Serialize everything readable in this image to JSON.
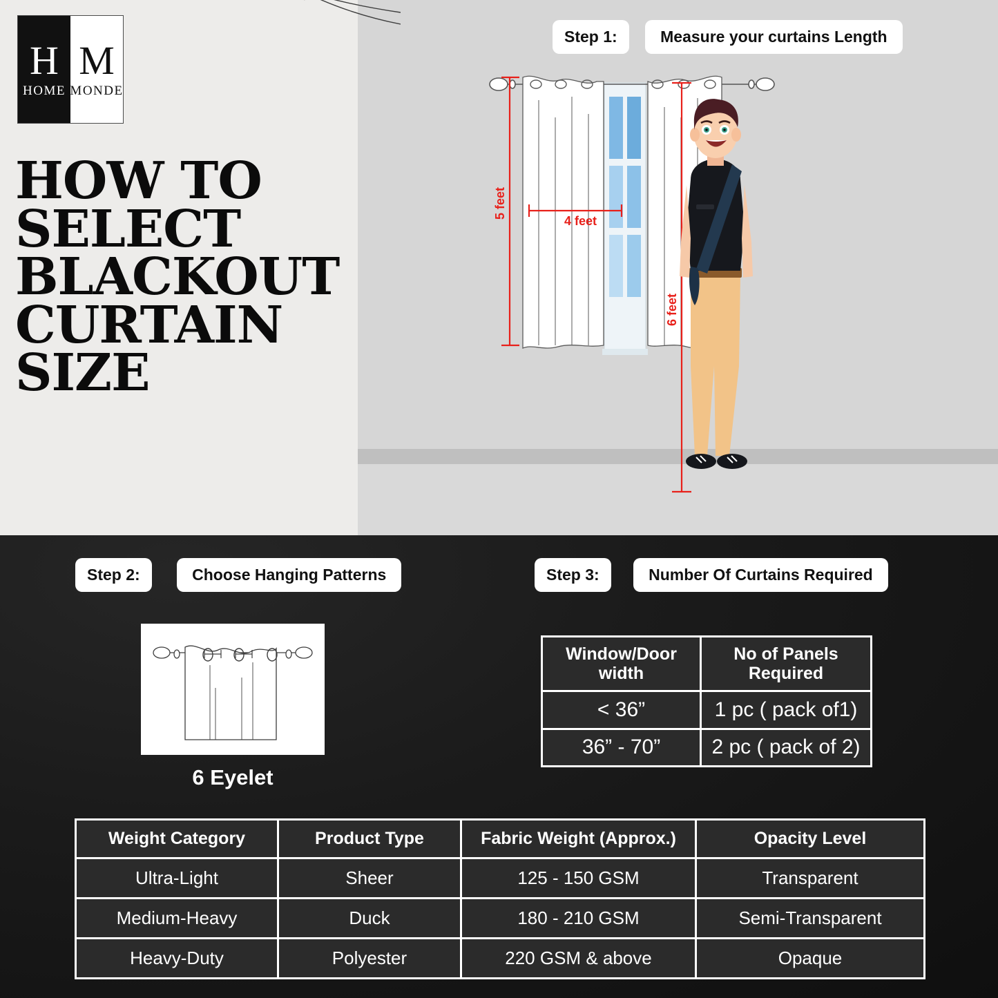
{
  "brand": {
    "letter_left": "H",
    "letter_right": "M",
    "word_left": "HOME",
    "word_right": "MONDE"
  },
  "headline": {
    "line1": "HOW TO",
    "line2": "SELECT",
    "line3": "BLACKOUT",
    "line4": "CURTAIN",
    "line5": "SIZE"
  },
  "steps": {
    "step1": {
      "badge": "Step 1:",
      "title": "Measure your curtains Length"
    },
    "step2": {
      "badge": "Step 2:",
      "title": "Choose Hanging Patterns"
    },
    "step3": {
      "badge": "Step 3:",
      "title": "Number Of Curtains Required"
    }
  },
  "measurements": {
    "height_label": "5 feet",
    "width_label": "4 feet",
    "drop_label": "6 feet",
    "color": "#e8201a"
  },
  "hanging_pattern": {
    "caption": "6 Eyelet"
  },
  "panels_table": {
    "headers": [
      "Window/Door width",
      "No of Panels Required"
    ],
    "rows": [
      [
        "< 36”",
        "1 pc ( pack of1)"
      ],
      [
        "36” - 70”",
        "2 pc ( pack of 2)"
      ]
    ]
  },
  "weights_table": {
    "headers": [
      "Weight Category",
      "Product Type",
      "Fabric Weight (Approx.)",
      "Opacity Level"
    ],
    "rows": [
      [
        "Ultra-Light",
        "Sheer",
        "125 - 150 GSM",
        "Transparent"
      ],
      [
        "Medium-Heavy",
        "Duck",
        "180 - 210 GSM",
        "Semi-Transparent"
      ],
      [
        "Heavy-Duty",
        "Polyester",
        "220  GSM & above",
        "Opaque"
      ]
    ]
  },
  "theme": {
    "light_panel": "#edecea",
    "room_wall": "#d6d6d6",
    "dark_section": "#161616",
    "accent_red": "#e8201a"
  }
}
